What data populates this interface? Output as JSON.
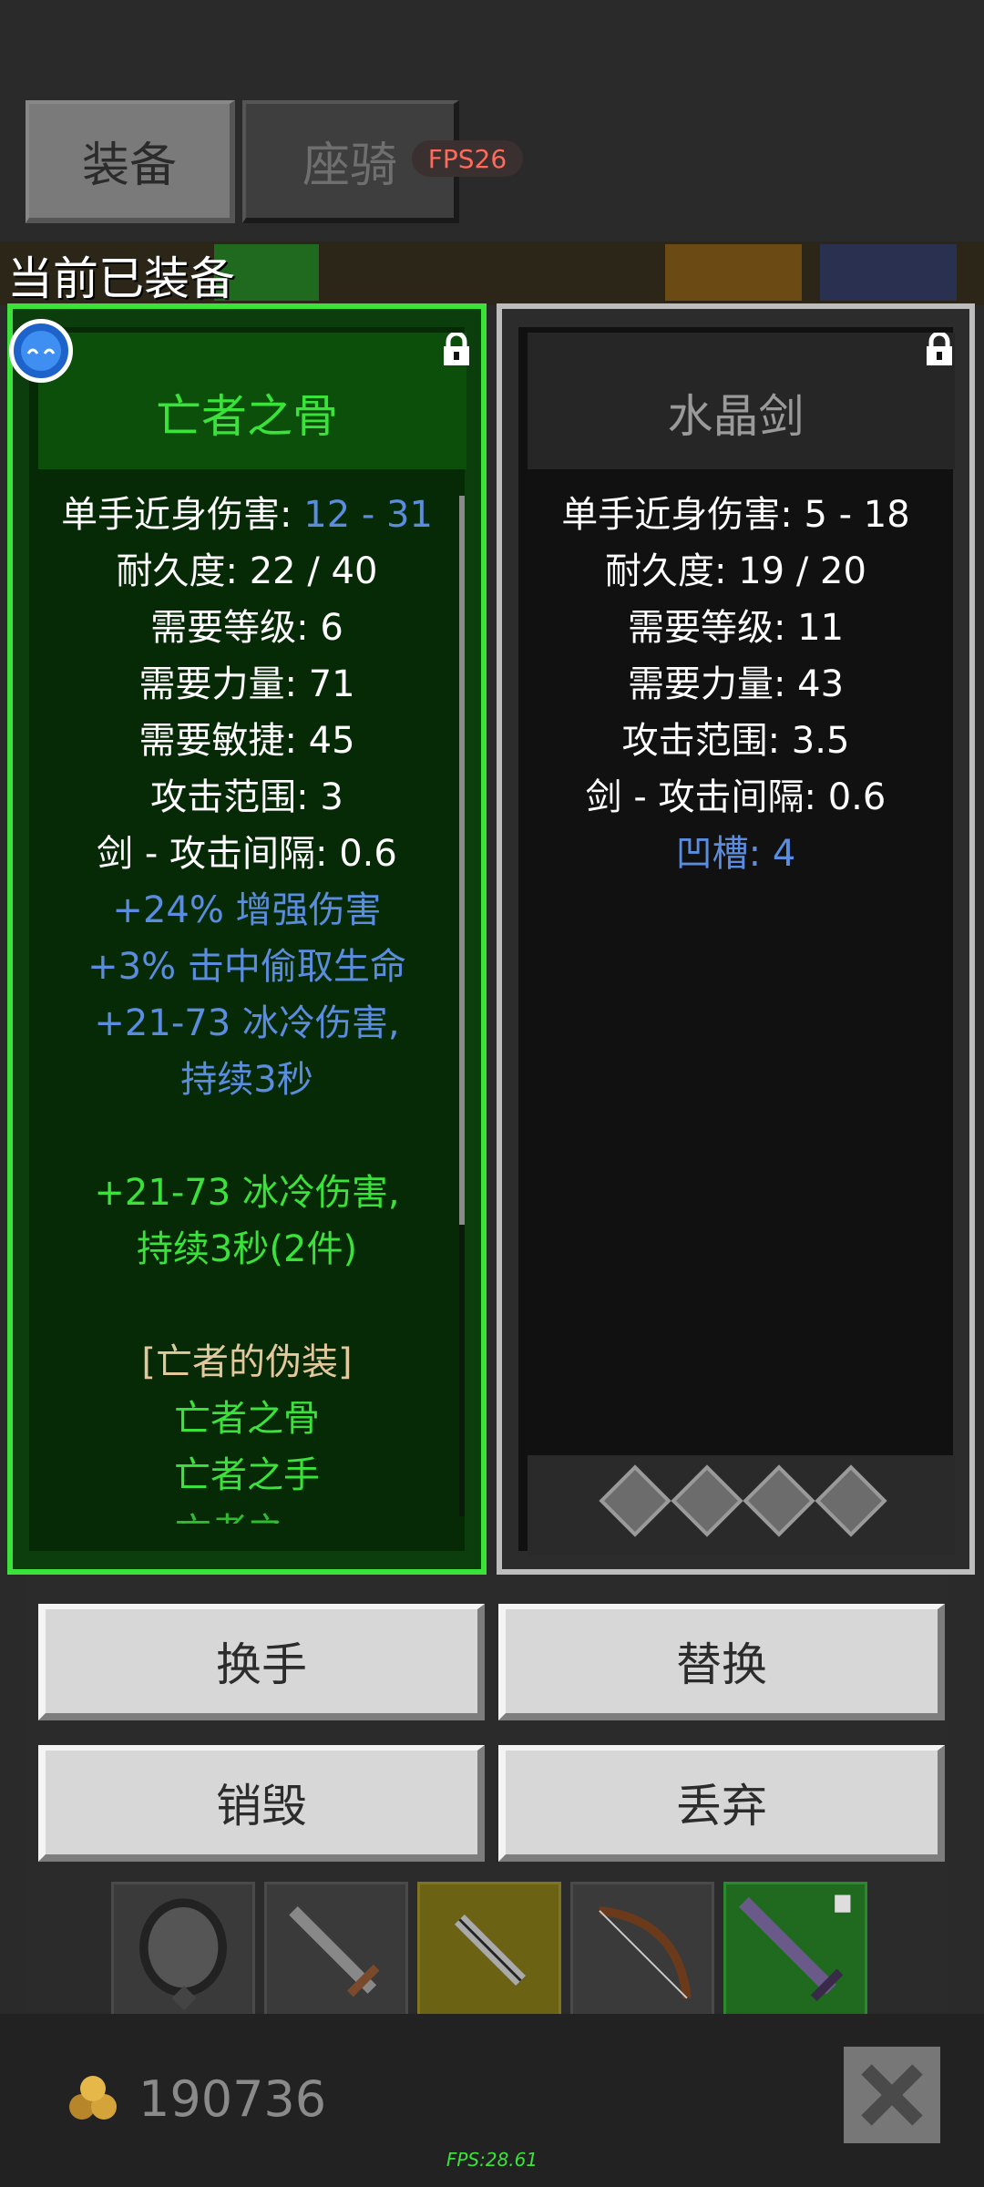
{
  "tabs": {
    "equipment": "装备",
    "mount": "座骑",
    "fps_badge": "FPS26"
  },
  "section_title": "当前已装备",
  "left_item": {
    "name": "亡者之骨",
    "stats": [
      {
        "label": "单手近身伤害: ",
        "value": "12 - 31"
      },
      {
        "text": "耐久度: 22 / 40"
      },
      {
        "text": "需要等级: 6"
      },
      {
        "text": "需要力量: 71"
      },
      {
        "text": "需要敏捷: 45"
      },
      {
        "text": "攻击范围: 3"
      },
      {
        "text": "剑 - 攻击间隔: 0.6"
      }
    ],
    "magic_stats": [
      "+24% 增强伤害",
      "+3% 击中偷取生命",
      "+21-73 冰冷伤害,",
      "持续3秒"
    ],
    "set_bonus": [
      "+21-73 冰冷伤害,",
      "持续3秒(2件)"
    ],
    "set_name": "[亡者的伪装]",
    "set_items": [
      "亡者之骨",
      "亡者之手",
      "亡者之..."
    ]
  },
  "right_item": {
    "name": "水晶剑",
    "stats": [
      "单手近身伤害: 5 - 18",
      "耐久度: 19 / 20",
      "需要等级: 11",
      "需要力量: 43",
      "攻击范围: 3.5",
      "剑 - 攻击间隔: 0.6"
    ],
    "sockets_label": "凹槽: 4",
    "socket_count": 4
  },
  "actions": {
    "swap_hand": "换手",
    "replace": "替换",
    "destroy": "销毁",
    "discard": "丢弃"
  },
  "gold": "190736",
  "fps_footer": "FPS:28.61",
  "colors": {
    "set_green": "#3ae23a",
    "magic_blue": "#5a8de0",
    "set_name": "#e2c89a"
  }
}
